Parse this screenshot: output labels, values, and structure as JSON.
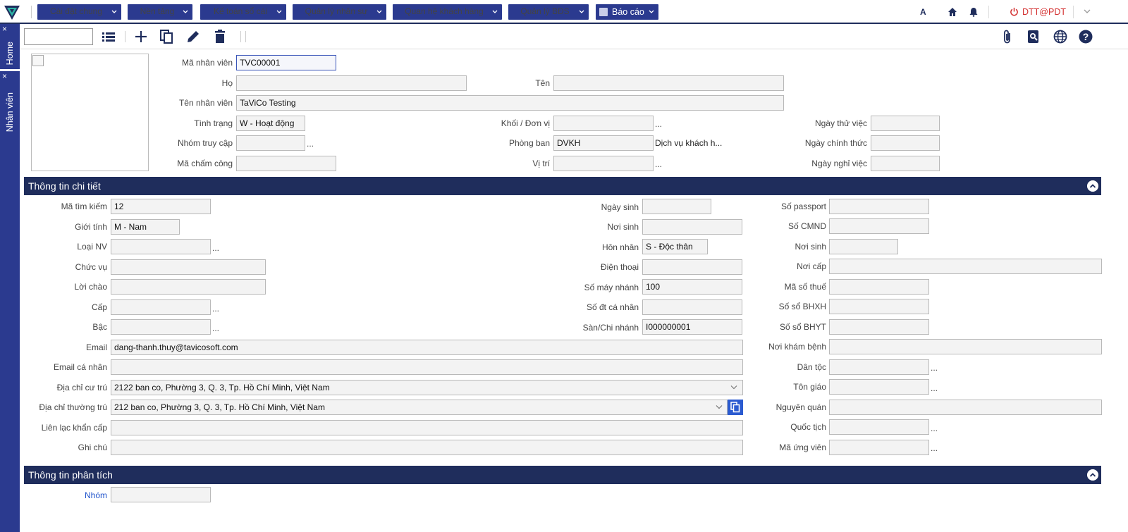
{
  "nav": {
    "menus": [
      {
        "label": "Cài đặt chung"
      },
      {
        "label": "Nền tảng"
      },
      {
        "label": "Kế toán sổ cái"
      },
      {
        "label": "Quản lý nhân sự"
      },
      {
        "label": "Quan hệ khách hàng"
      },
      {
        "label": "Quản lý BĐS"
      },
      {
        "label": "Báo cáo"
      }
    ],
    "font_btn": "A",
    "user": "DTT@PDT"
  },
  "sidebar": {
    "tabs": [
      {
        "label": "Home",
        "close": "×"
      },
      {
        "label": "Nhân viên",
        "close": "×"
      }
    ]
  },
  "header_fields": {
    "ma_nv": {
      "label": "Mã nhân viên",
      "value": "TVC00001"
    },
    "ho": {
      "label": "Họ",
      "value": ""
    },
    "ten": {
      "label": "Tên",
      "value": ""
    },
    "ten_nv": {
      "label": "Tên nhân viên",
      "value": "TaViCo Testing"
    },
    "tinh_trang": {
      "label": "Tình trạng",
      "value": "W - Hoạt động"
    },
    "khoi": {
      "label": "Khối / Đơn vị",
      "value": ""
    },
    "ngay_thu_viec": {
      "label": "Ngày thử việc",
      "value": ""
    },
    "nhom_truy_cap": {
      "label": "Nhóm truy cập",
      "value": ""
    },
    "phong_ban": {
      "label": "Phòng ban",
      "value": "DVKH",
      "desc": "Dịch vụ khách h..."
    },
    "ngay_chinh_thuc": {
      "label": "Ngày chính thức",
      "value": ""
    },
    "ma_cham_cong": {
      "label": "Mã chấm công",
      "value": ""
    },
    "vi_tri": {
      "label": "Vị trí",
      "value": ""
    },
    "ngay_nghi_viec": {
      "label": "Ngày nghỉ việc",
      "value": ""
    }
  },
  "sections": {
    "detail": "Thông tin chi tiết",
    "analysis": "Thông tin phân tích"
  },
  "detail": {
    "col1": {
      "ma_tim_kiem": {
        "label": "Mã tìm kiếm",
        "value": "12"
      },
      "gioi_tinh": {
        "label": "Giới tính",
        "value": "M - Nam"
      },
      "loai_nv": {
        "label": "Loại NV",
        "value": ""
      },
      "chuc_vu": {
        "label": "Chức vụ",
        "value": ""
      },
      "loi_chao": {
        "label": "Lời chào",
        "value": ""
      },
      "cap": {
        "label": "Cấp",
        "value": ""
      },
      "bac": {
        "label": "Bậc",
        "value": ""
      },
      "email": {
        "label": "Email",
        "value": "dang-thanh.thuy@tavicosoft.com"
      },
      "email_cn": {
        "label": "Email cá nhân",
        "value": ""
      },
      "dc_cu_tru": {
        "label": "Địa chỉ cư trú",
        "value": "2122 ban co, Phường 3, Q. 3, Tp. Hồ Chí Minh, Việt Nam"
      },
      "dc_thuong_tru": {
        "label": "Địa chỉ thường trú",
        "value": "212 ban co, Phường 3, Q. 3, Tp. Hồ Chí Minh, Việt Nam"
      },
      "lien_lac": {
        "label": "Liên lạc khẩn cấp",
        "value": ""
      },
      "ghi_chu": {
        "label": "Ghi chú",
        "value": ""
      }
    },
    "col2": {
      "ngay_sinh": {
        "label": "Ngày sinh",
        "value": ""
      },
      "noi_sinh": {
        "label": "Nơi sinh",
        "value": ""
      },
      "hon_nhan": {
        "label": "Hôn nhân",
        "value": "S - Độc thân"
      },
      "dien_thoai": {
        "label": "Điện thoại",
        "value": ""
      },
      "so_may_nhanh": {
        "label": "Số máy nhánh",
        "value": "100"
      },
      "so_dt_cn": {
        "label": "Số đt cá nhân",
        "value": ""
      },
      "san_chi_nhanh": {
        "label": "Sàn/Chi nhánh",
        "value": "I000000001"
      }
    },
    "col3": {
      "passport": {
        "label": "Số passport",
        "value": ""
      },
      "cmnd": {
        "label": "Số CMND",
        "value": ""
      },
      "noi_sinh": {
        "label": "Nơi sinh",
        "value": ""
      },
      "noi_cap": {
        "label": "Nơi cấp",
        "value": ""
      },
      "ma_so_thue": {
        "label": "Mã số thuế",
        "value": ""
      },
      "bhxh": {
        "label": "Số sổ BHXH",
        "value": ""
      },
      "bhyt": {
        "label": "Số sổ BHYT",
        "value": ""
      },
      "noi_kham": {
        "label": "Nơi khám bệnh",
        "value": ""
      },
      "dan_toc": {
        "label": "Dân tộc",
        "value": ""
      },
      "ton_giao": {
        "label": "Tôn giáo",
        "value": ""
      },
      "nguyen_quan": {
        "label": "Nguyên quán",
        "value": ""
      },
      "quoc_tich": {
        "label": "Quốc tịch",
        "value": ""
      },
      "ma_ung_vien": {
        "label": "Mã ứng viên",
        "value": ""
      }
    }
  },
  "analysis": {
    "nhom": {
      "label": "Nhóm",
      "value": ""
    }
  },
  "dots": "...",
  "colors": {
    "nav": "#2b3a8f",
    "section": "#1f2d5c",
    "user": "#d32f2f"
  }
}
